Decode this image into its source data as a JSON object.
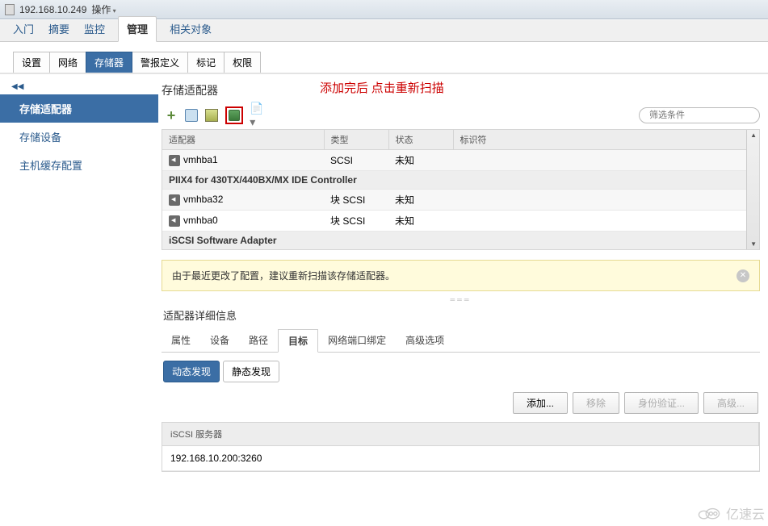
{
  "titleBar": {
    "ip": "192.168.10.249",
    "menu": "操作"
  },
  "topNav": {
    "items": [
      "入门",
      "摘要",
      "监控"
    ],
    "active": "管理",
    "after": "相关对象"
  },
  "subTabs": {
    "items": [
      "设置",
      "网络",
      "存储器",
      "警报定义",
      "标记",
      "权限"
    ],
    "active": "存储器"
  },
  "sidebar": {
    "items": [
      "存储适配器",
      "存储设备",
      "主机缓存配置"
    ],
    "active": "存储适配器"
  },
  "panel": {
    "title": "存储适配器",
    "annotation": "添加完后 点击重新扫描"
  },
  "searchPlaceholder": "筛选条件",
  "table": {
    "headers": [
      "适配器",
      "类型",
      "状态",
      "标识符"
    ],
    "rows": [
      {
        "type": "adapter",
        "name": "vmhba1",
        "kind": "SCSI",
        "status": "未知"
      },
      {
        "type": "group",
        "label": "PIIX4 for 430TX/440BX/MX IDE Controller"
      },
      {
        "type": "adapter",
        "name": "vmhba32",
        "kind": "块 SCSI",
        "status": "未知"
      },
      {
        "type": "adapter",
        "name": "vmhba0",
        "kind": "块 SCSI",
        "status": "未知"
      },
      {
        "type": "group",
        "label": "iSCSI Software Adapter"
      }
    ]
  },
  "warning": "由于最近更改了配置，建议重新扫描该存储适配器。",
  "detail": {
    "title": "适配器详细信息",
    "tabs": [
      "属性",
      "设备",
      "路径",
      "目标",
      "网络端口绑定",
      "高级选项"
    ],
    "activeTab": "目标",
    "discovery": {
      "active": "动态发现",
      "other": "静态发现"
    },
    "buttons": {
      "add": "添加...",
      "remove": "移除",
      "auth": "身份验证...",
      "adv": "高级..."
    },
    "server": {
      "header": "iSCSI 服务器",
      "value": "192.168.10.200:3260"
    }
  },
  "watermark": "亿速云"
}
